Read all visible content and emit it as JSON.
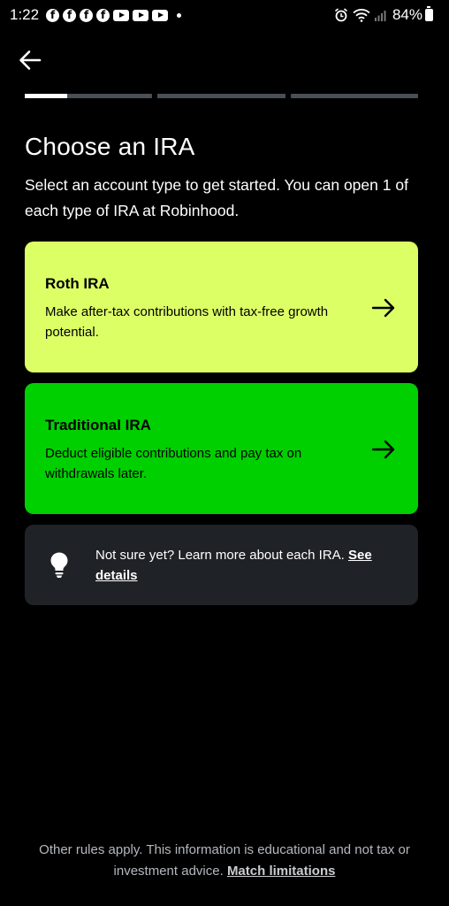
{
  "status_bar": {
    "time": "1:22",
    "battery": "84%",
    "notification_icons": [
      "facebook-icon",
      "facebook-icon",
      "facebook-icon",
      "facebook-icon",
      "youtube-icon",
      "youtube-icon",
      "youtube-icon"
    ],
    "system_icons": [
      "alarm-icon",
      "wifi-icon",
      "signal-icon",
      "battery-icon"
    ]
  },
  "nav": {
    "back_icon": "arrow-left-icon"
  },
  "progress": {
    "steps": 3,
    "current_step_fraction": 0.33
  },
  "header": {
    "title": "Choose an IRA",
    "subtitle": "Select an account type to get started. You can open 1 of each type of IRA at Robinhood."
  },
  "options": [
    {
      "title": "Roth IRA",
      "description": "Make after-tax contributions with tax-free growth potential.",
      "color": "#ddff66",
      "icon": "arrow-right-icon"
    },
    {
      "title": "Traditional IRA",
      "description": "Deduct eligible contributions and pay tax on withdrawals later.",
      "color": "#00d000",
      "icon": "arrow-right-icon"
    }
  ],
  "info": {
    "icon": "lightbulb-icon",
    "text": "Not sure yet? Learn more about each IRA. ",
    "link": "See details"
  },
  "footer": {
    "text": "Other rules apply. This information is educational and not tax or investment advice. ",
    "link": "Match limitations"
  },
  "colors": {
    "background": "#000000",
    "roth_card": "#ddff66",
    "traditional_card": "#00d000",
    "info_box": "#1f2226",
    "progress_track": "#4a4f56"
  }
}
